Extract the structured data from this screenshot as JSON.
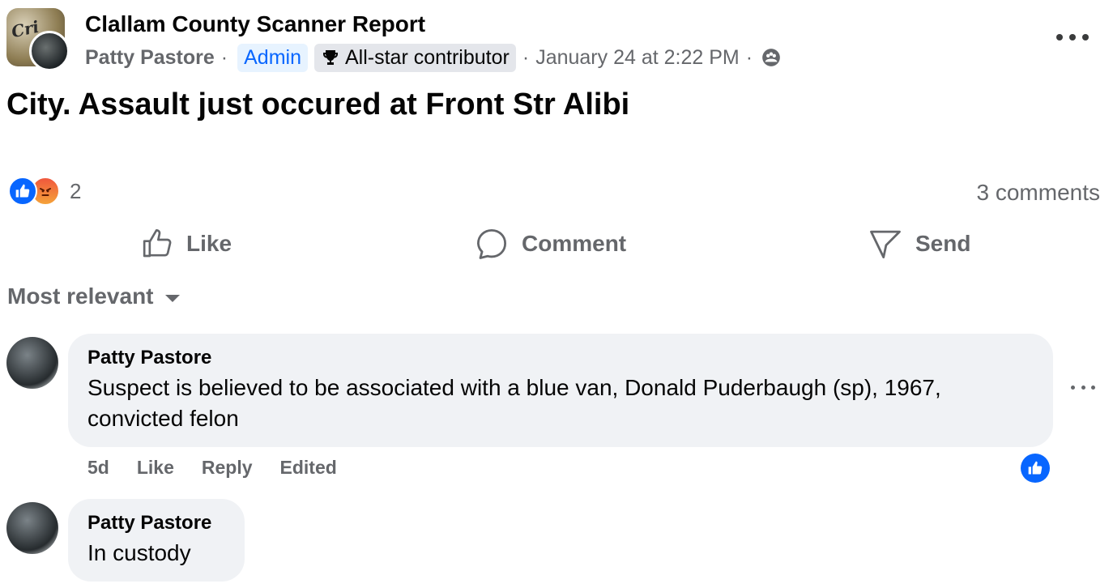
{
  "post": {
    "group_name": "Clallam County Scanner Report",
    "group_avatar_text": "Cri",
    "author": "Patty Pastore",
    "separator": "·",
    "admin_badge": "Admin",
    "allstar_badge": "All-star contributor",
    "timestamp": "January 24 at 2:22 PM",
    "text": "City. Assault just occured at Front Str Alibi"
  },
  "reactions": {
    "count": "2",
    "comments": "3 comments",
    "like_color": "#0866ff"
  },
  "actions": {
    "like": "Like",
    "comment": "Comment",
    "send": "Send"
  },
  "sort": {
    "label": "Most relevant"
  },
  "comments": [
    {
      "author": "Patty Pastore",
      "text": "Suspect is believed to be associated with a blue van, Donald Puderbaugh (sp), 1967, convicted felon",
      "age": "5d",
      "like": "Like",
      "reply": "Reply",
      "edited": "Edited"
    },
    {
      "author": "Patty Pastore",
      "text": "In custody"
    }
  ]
}
